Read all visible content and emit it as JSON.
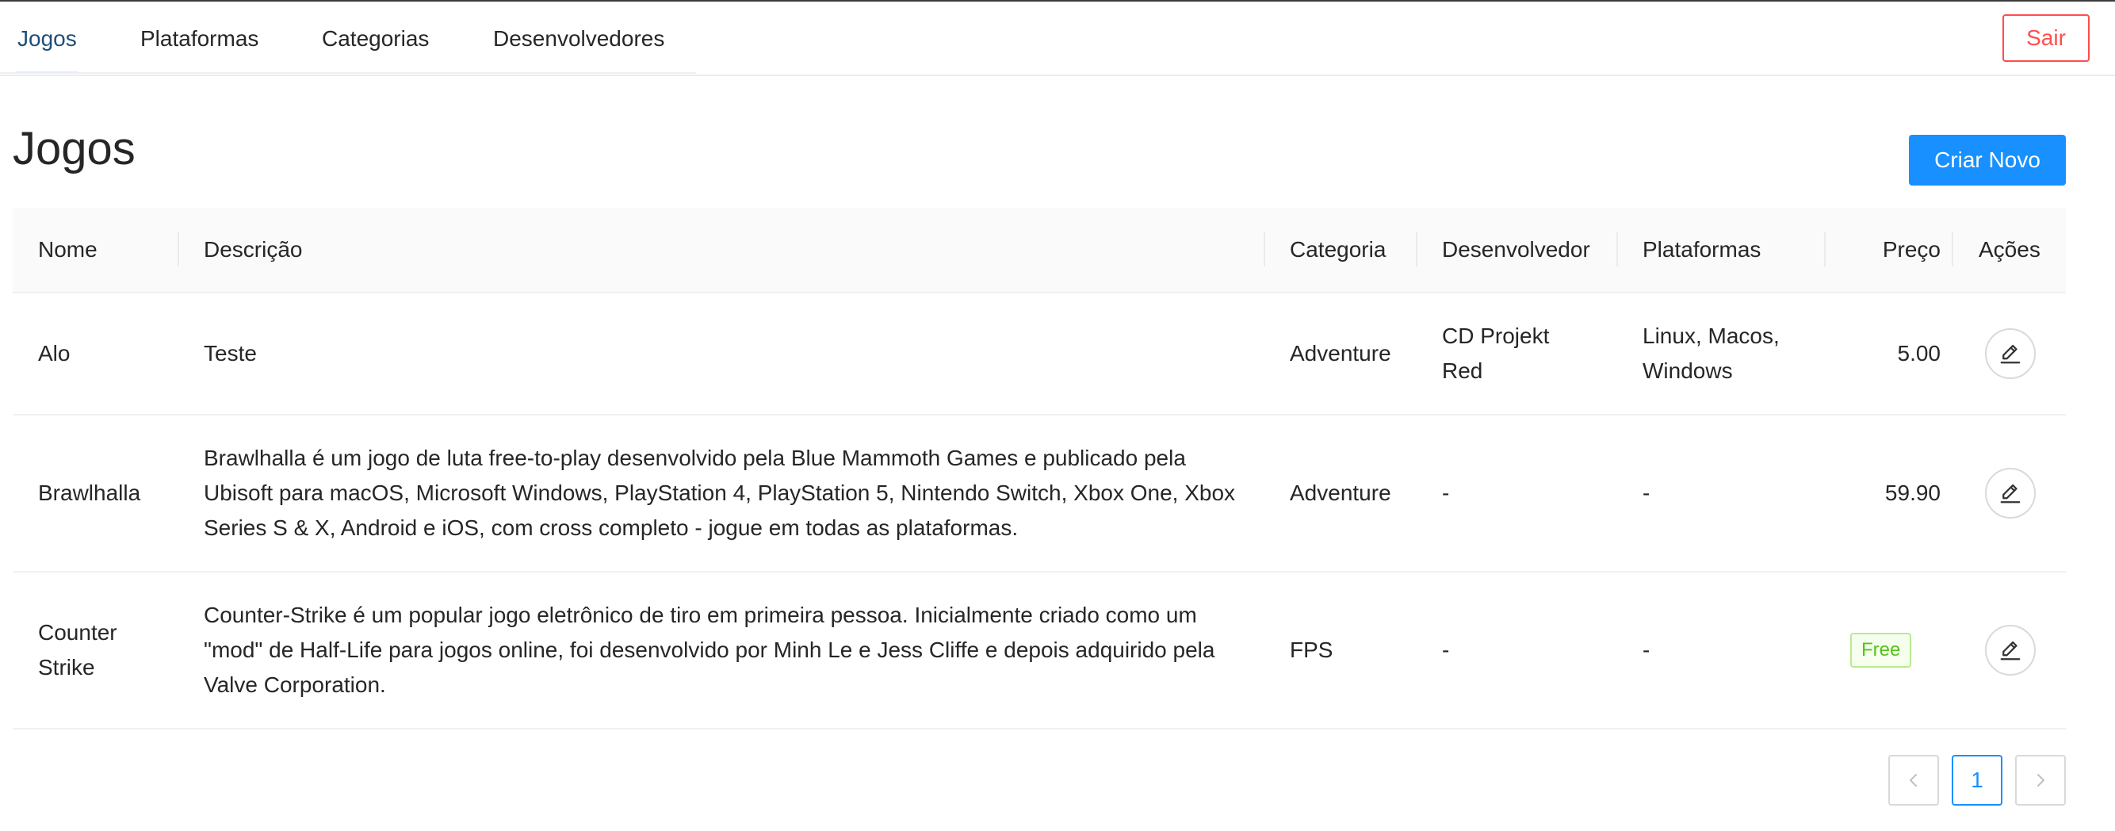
{
  "nav": {
    "tabs": [
      {
        "label": "Jogos",
        "active": true
      },
      {
        "label": "Plataformas",
        "active": false
      },
      {
        "label": "Categorias",
        "active": false
      },
      {
        "label": "Desenvolvedores",
        "active": false
      }
    ],
    "logout_label": "Sair"
  },
  "page": {
    "title": "Jogos",
    "create_label": "Criar Novo"
  },
  "table": {
    "headers": [
      "Nome",
      "Descrição",
      "Categoria",
      "Desenvolvedor",
      "Plataformas",
      "Preço",
      "Ações"
    ],
    "rows": [
      {
        "name": "Alo",
        "description": "Teste",
        "category": "Adventure",
        "developer": "CD Projekt Red",
        "platforms": "Linux, Macos, Windows",
        "price": "5.00"
      },
      {
        "name": "Brawlhalla",
        "description": "Brawlhalla é um jogo de luta free-to-play desenvolvido pela Blue Mammoth Games e publicado pela Ubisoft para macOS, Microsoft Windows, PlayStation 4, PlayStation 5, Nintendo Switch, Xbox One, Xbox Series S & X, Android e iOS, com cross completo - jogue em todas as plataformas.",
        "category": "Adventure",
        "developer": "-",
        "platforms": "-",
        "price": "59.90"
      },
      {
        "name": "Counter Strike",
        "description": "Counter-Strike é um popular jogo eletrônico de tiro em primeira pessoa. Inicialmente criado como um \"mod\" de Half-Life para jogos online, foi desenvolvido por Minh Le e Jess Cliffe e depois adquirido pela Valve Corporation.",
        "category": "FPS",
        "developer": "-",
        "platforms": "-",
        "price": "Free"
      }
    ]
  },
  "pagination": {
    "current_page": "1"
  },
  "colors": {
    "primary": "#1890ff",
    "danger": "#ff4d4f",
    "free_tag": "#52c41a"
  },
  "icons": {
    "edit": "edit-icon",
    "prev": "chevron-left-icon",
    "next": "chevron-right-icon"
  }
}
